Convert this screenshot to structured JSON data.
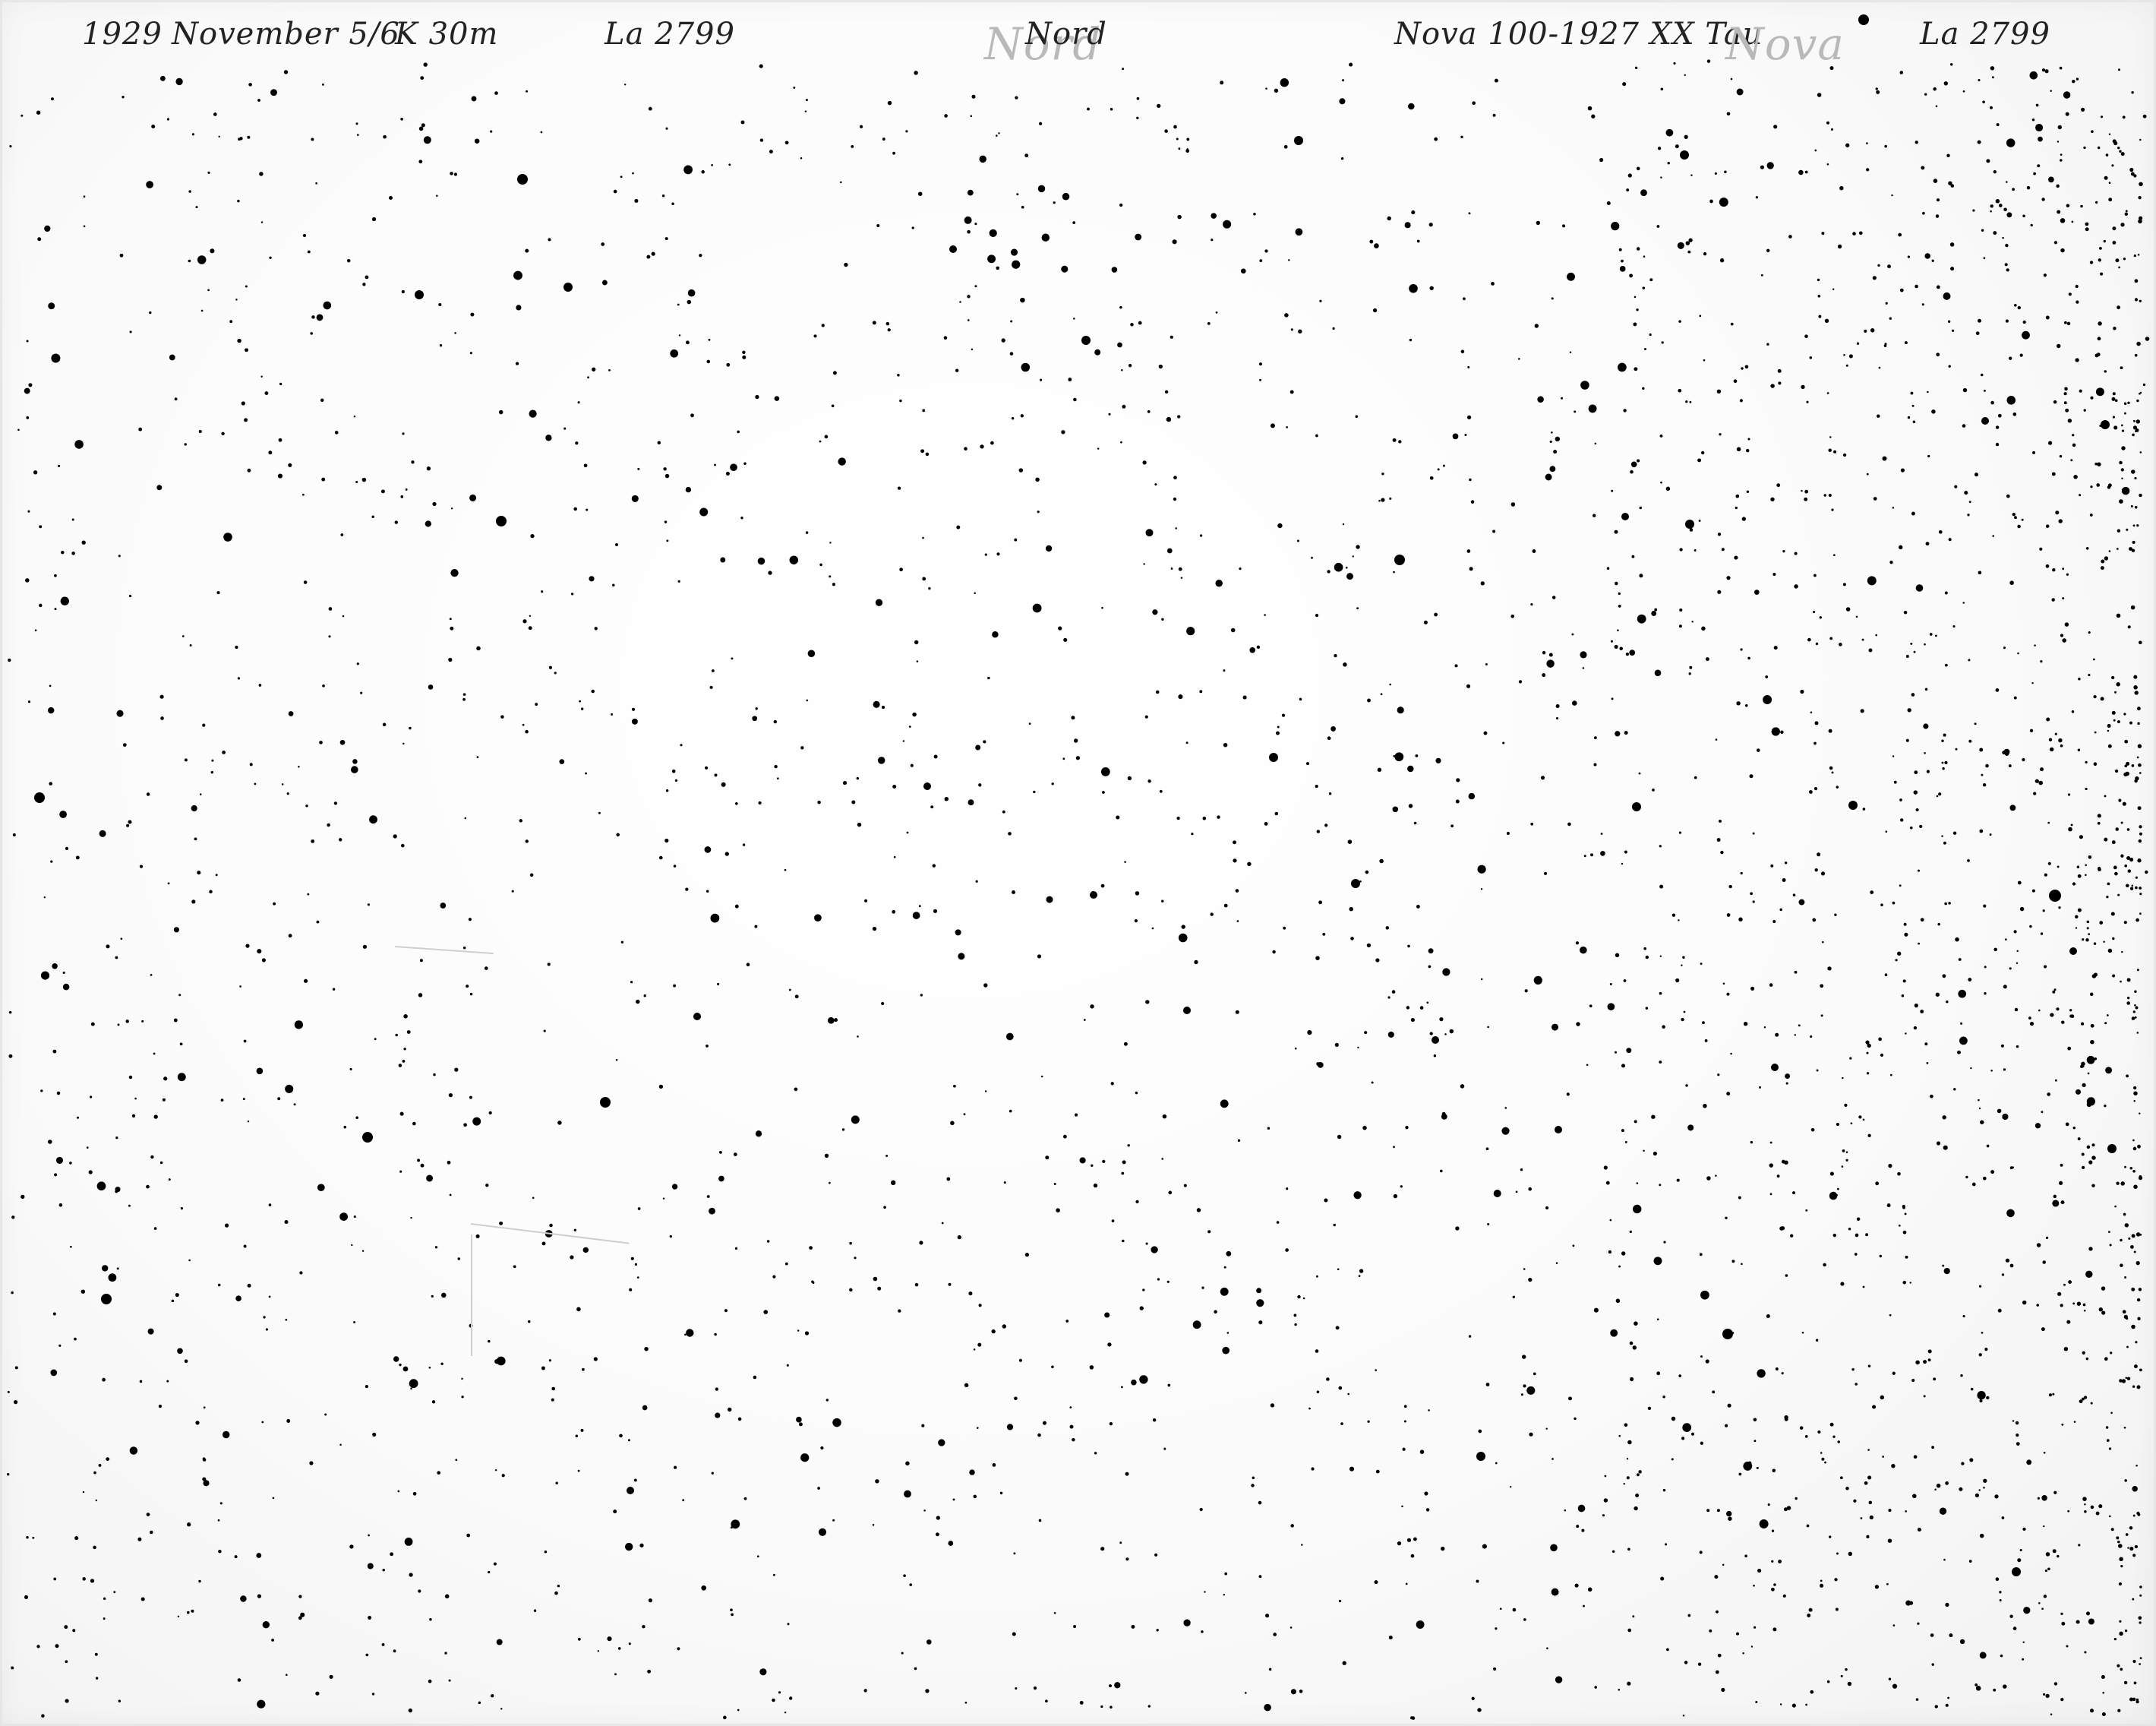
{
  "plate": {
    "background_color": "#ffffff",
    "star_color": "#000000",
    "annotation_color": "#222222",
    "faint_annotation_color": "#b9b9b9"
  },
  "annotations": {
    "year": "1929",
    "date": "November 5/6",
    "exposure": "K 30m",
    "plate_id_left": "La 2799",
    "direction": "Nord",
    "target": "Nova 100-1927 XX Tau",
    "plate_id_right": "La 2799",
    "faint_left": "Nord",
    "faint_right": "Nova"
  }
}
